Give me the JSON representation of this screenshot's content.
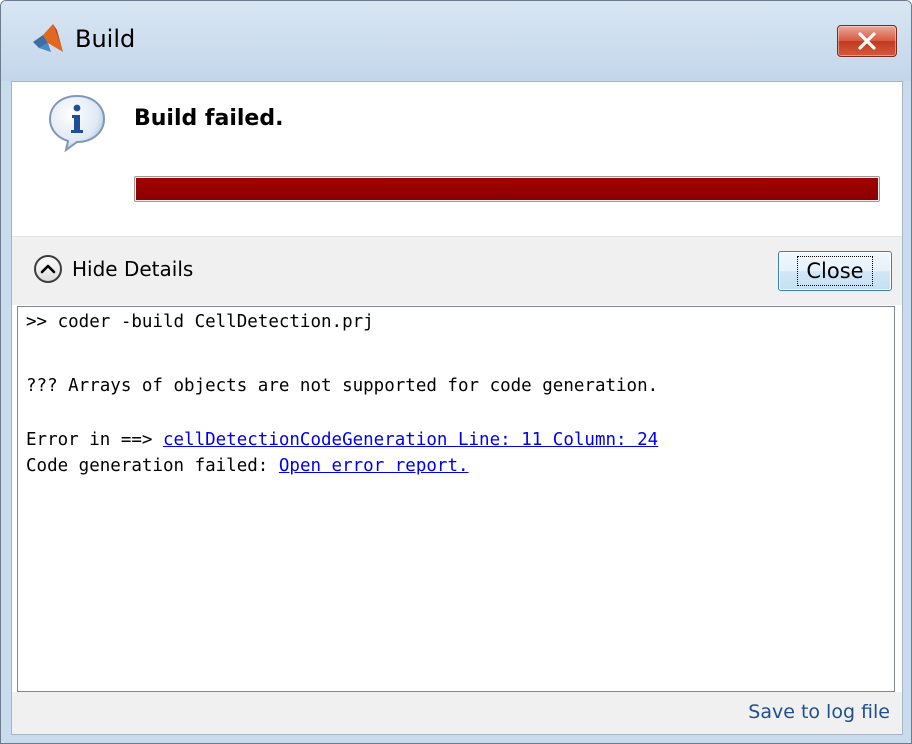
{
  "window": {
    "title": "Build",
    "icon": "matlab-logo-icon",
    "close_icon": "close-icon"
  },
  "status": {
    "icon": "info-icon",
    "message": "Build failed.",
    "progress_fraction": 1.0,
    "progress_color": "#990000"
  },
  "details": {
    "toggle_label": "Hide Details",
    "toggle_icon": "chevron-up-icon",
    "close_label": "Close"
  },
  "console": {
    "command": ">> coder -build CellDetection.prj",
    "error_message": "??? Arrays of objects are not supported for code generation.",
    "error_prefix": "Error in ==> ",
    "error_link": "cellDetectionCodeGeneration Line: 11 Column: 24",
    "failed_prefix": "Code generation failed: ",
    "report_link": "Open error report."
  },
  "footer": {
    "save_label": "Save to log file"
  },
  "colors": {
    "link": "#0000ee",
    "progress": "#990000"
  }
}
